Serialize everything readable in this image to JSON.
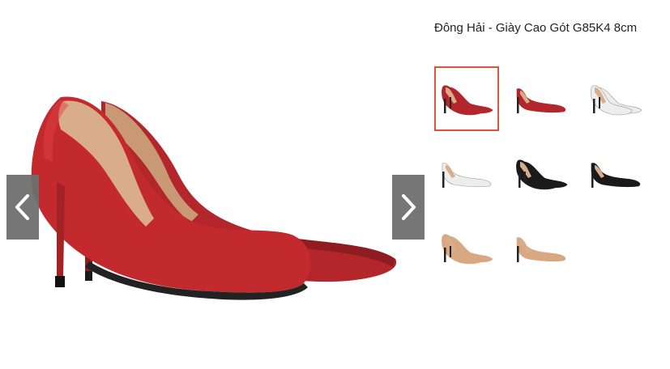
{
  "product": {
    "title": "Đông Hải - Giày Cao Gót G85K4 8cm"
  },
  "gallery": {
    "main_image_icon": "red-pump-pair-image",
    "prev_icon": "chevron-left-icon",
    "next_icon": "chevron-right-icon",
    "selected_index": 0,
    "thumbnails": [
      {
        "icon": "red-pump-pair-thumbnail",
        "color": "#b3262b"
      },
      {
        "icon": "red-pump-side-thumbnail",
        "color": "#b3262b"
      },
      {
        "icon": "white-pump-pair-thumbnail",
        "color": "#ededed"
      },
      {
        "icon": "white-pump-side-thumbnail",
        "color": "#ededed"
      },
      {
        "icon": "black-pump-pair-thumbnail",
        "color": "#1a1a1a"
      },
      {
        "icon": "black-pump-side-thumbnail",
        "color": "#1a1a1a"
      },
      {
        "icon": "nude-pump-pair-thumbnail",
        "color": "#d9a883"
      },
      {
        "icon": "nude-pump-side-thumbnail",
        "color": "#d9a883"
      }
    ]
  },
  "colors": {
    "selected_border": "#e0533d",
    "arrow_bg": "#6f6f6f"
  }
}
